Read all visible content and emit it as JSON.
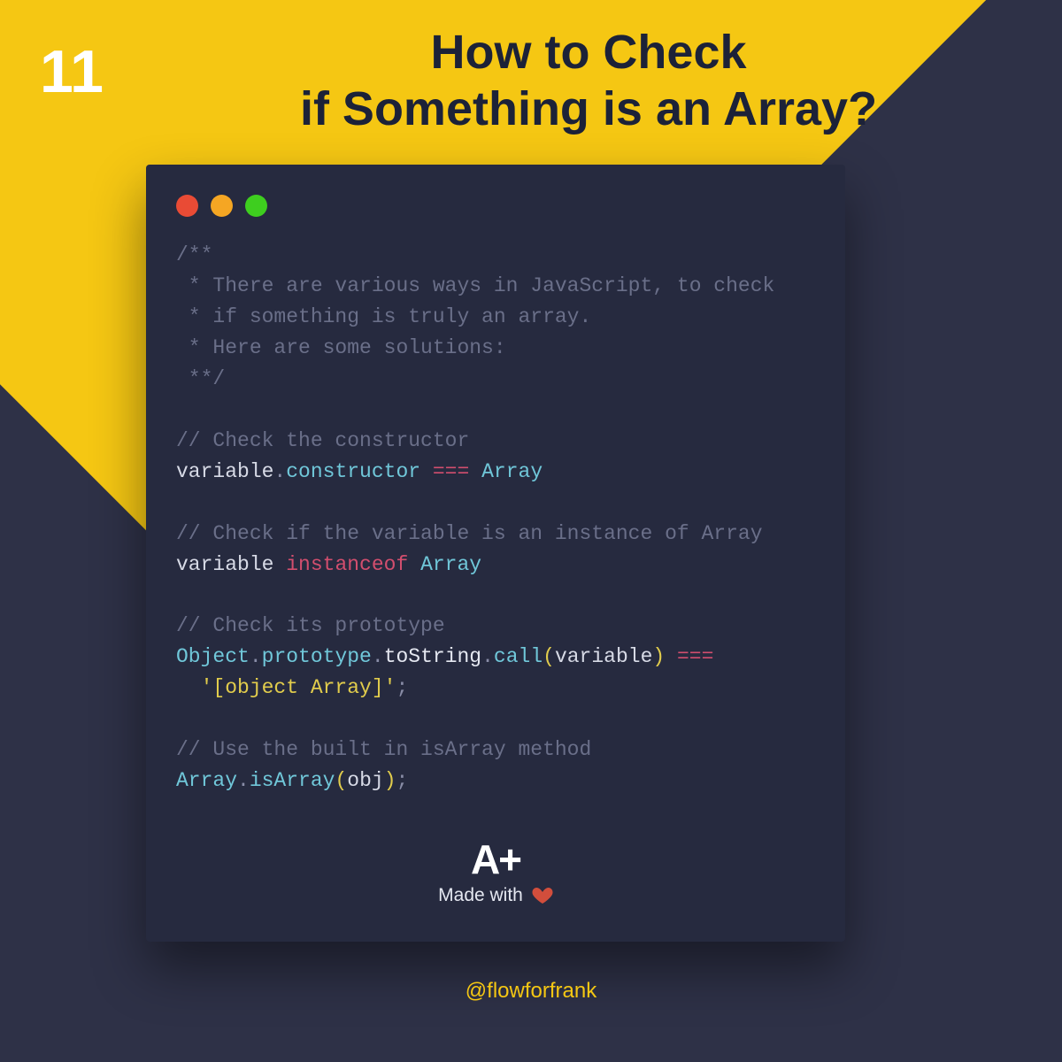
{
  "page_number": "11",
  "title_line1": "How to Check",
  "title_line2": "if Something is an Array?",
  "code_lines": [
    {
      "segments": [
        {
          "cls": "comment",
          "text": "/**"
        }
      ]
    },
    {
      "segments": [
        {
          "cls": "comment",
          "text": " * There are various ways in JavaScript, to check"
        }
      ]
    },
    {
      "segments": [
        {
          "cls": "comment",
          "text": " * if something is truly an array."
        }
      ]
    },
    {
      "segments": [
        {
          "cls": "comment",
          "text": " * Here are some solutions:"
        }
      ]
    },
    {
      "segments": [
        {
          "cls": "comment",
          "text": " **/"
        }
      ]
    },
    {
      "segments": [
        {
          "cls": "plain",
          "text": ""
        }
      ]
    },
    {
      "segments": [
        {
          "cls": "comment",
          "text": "// Check the constructor"
        }
      ]
    },
    {
      "segments": [
        {
          "cls": "plain",
          "text": "variable"
        },
        {
          "cls": "punc",
          "text": "."
        },
        {
          "cls": "prop",
          "text": "constructor"
        },
        {
          "cls": "plain",
          "text": " "
        },
        {
          "cls": "op",
          "text": "==="
        },
        {
          "cls": "plain",
          "text": " "
        },
        {
          "cls": "class",
          "text": "Array"
        }
      ]
    },
    {
      "segments": [
        {
          "cls": "plain",
          "text": ""
        }
      ]
    },
    {
      "segments": [
        {
          "cls": "comment",
          "text": "// Check if the variable is an instance of Array"
        }
      ]
    },
    {
      "segments": [
        {
          "cls": "plain",
          "text": "variable "
        },
        {
          "cls": "keyword",
          "text": "instanceof"
        },
        {
          "cls": "plain",
          "text": " "
        },
        {
          "cls": "class",
          "text": "Array"
        }
      ]
    },
    {
      "segments": [
        {
          "cls": "plain",
          "text": ""
        }
      ]
    },
    {
      "segments": [
        {
          "cls": "comment",
          "text": "// Check its prototype"
        }
      ]
    },
    {
      "segments": [
        {
          "cls": "class",
          "text": "Object"
        },
        {
          "cls": "punc",
          "text": "."
        },
        {
          "cls": "prop",
          "text": "prototype"
        },
        {
          "cls": "punc",
          "text": "."
        },
        {
          "cls": "func",
          "text": "toString"
        },
        {
          "cls": "punc",
          "text": "."
        },
        {
          "cls": "prop",
          "text": "call"
        },
        {
          "cls": "paren",
          "text": "("
        },
        {
          "cls": "plain",
          "text": "variable"
        },
        {
          "cls": "paren",
          "text": ")"
        },
        {
          "cls": "plain",
          "text": " "
        },
        {
          "cls": "op",
          "text": "==="
        }
      ]
    },
    {
      "segments": [
        {
          "cls": "plain",
          "text": "  "
        },
        {
          "cls": "string",
          "text": "'[object Array]'"
        },
        {
          "cls": "punc",
          "text": ";"
        }
      ]
    },
    {
      "segments": [
        {
          "cls": "plain",
          "text": ""
        }
      ]
    },
    {
      "segments": [
        {
          "cls": "comment",
          "text": "// Use the built in isArray method"
        }
      ]
    },
    {
      "segments": [
        {
          "cls": "class",
          "text": "Array"
        },
        {
          "cls": "punc",
          "text": "."
        },
        {
          "cls": "prop",
          "text": "isArray"
        },
        {
          "cls": "paren",
          "text": "("
        },
        {
          "cls": "plain",
          "text": "obj"
        },
        {
          "cls": "paren",
          "text": ")"
        },
        {
          "cls": "punc",
          "text": ";"
        }
      ]
    }
  ],
  "brand": "A+",
  "made_with": "Made with",
  "handle": "@flowforfrank"
}
